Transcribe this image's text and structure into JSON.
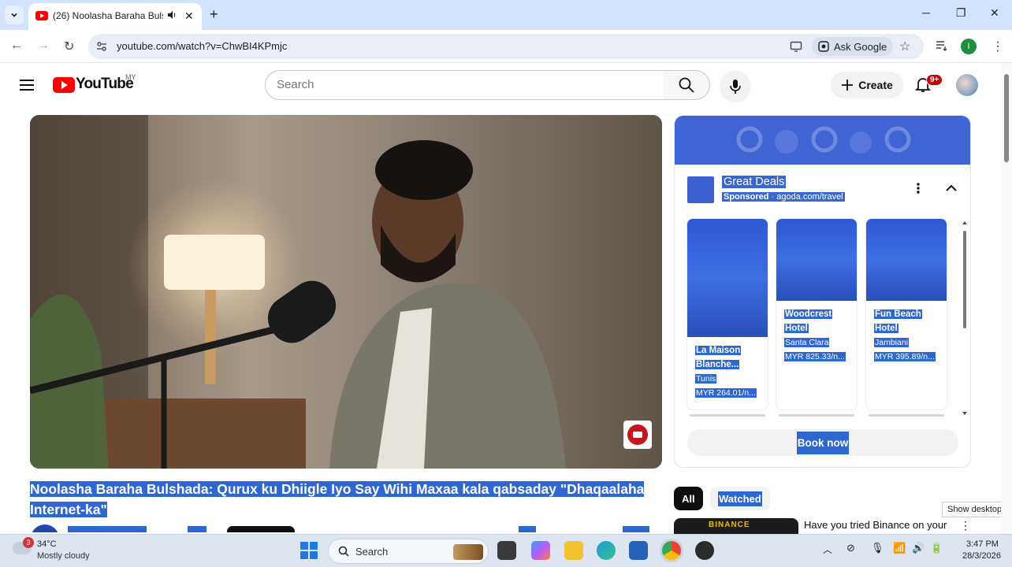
{
  "browser": {
    "tab_title": "(26) Noolasha Baraha Bulsh",
    "new_tab_symbol": "+",
    "url": "youtube.com/watch?v=ChwBI4KPmjc",
    "ask_google_label": "Ask Google",
    "profile_initial": "I",
    "accent": "#d3e3fd"
  },
  "youtube": {
    "logo_text": "YouTube",
    "country_code": "MY",
    "search_placeholder": "Search",
    "create_label": "Create",
    "notification_count": "9+",
    "brand_color": "#ff0000"
  },
  "video": {
    "title": "Noolasha Baraha Bulshada: Qurux ku Dhiigle Iyo Say Wihi Maxaa kala qabsaday \"Dhaqaalaha Internet-ka\""
  },
  "ad": {
    "title": "Great Deals",
    "sponsored_label": "Sponsored",
    "separator": "·",
    "domain": "agoda.com/travel",
    "hotels": [
      {
        "name_line1": "La Maison",
        "name_line2": "Blanche...",
        "location": "Tunis",
        "price": "MYR 264.01/n..."
      },
      {
        "name_line1": "Woodcrest",
        "name_line2": "Hotel",
        "location": "Santa Clara",
        "price": "MYR 825.33/n..."
      },
      {
        "name_line1": "Fun Beach",
        "name_line2": "Hotel",
        "location": "Jambiani",
        "price": "MYR 395.89/n..."
      }
    ],
    "cta_label": "Book now",
    "highlight_color": "#2d67cf"
  },
  "chips": [
    {
      "label": "All",
      "selected": true
    },
    {
      "label": "Watched",
      "selected": false
    }
  ],
  "recommendation": {
    "thumb_text": "BINANCE",
    "title": "Have you tried Binance on your"
  },
  "tooltip": {
    "show_desktop": "Show desktop"
  },
  "taskbar": {
    "weather_badge": "3",
    "temperature": "34°C",
    "weather_desc": "Mostly cloudy",
    "search_label": "Search",
    "time": "3:47 PM",
    "date": "28/3/2026"
  }
}
